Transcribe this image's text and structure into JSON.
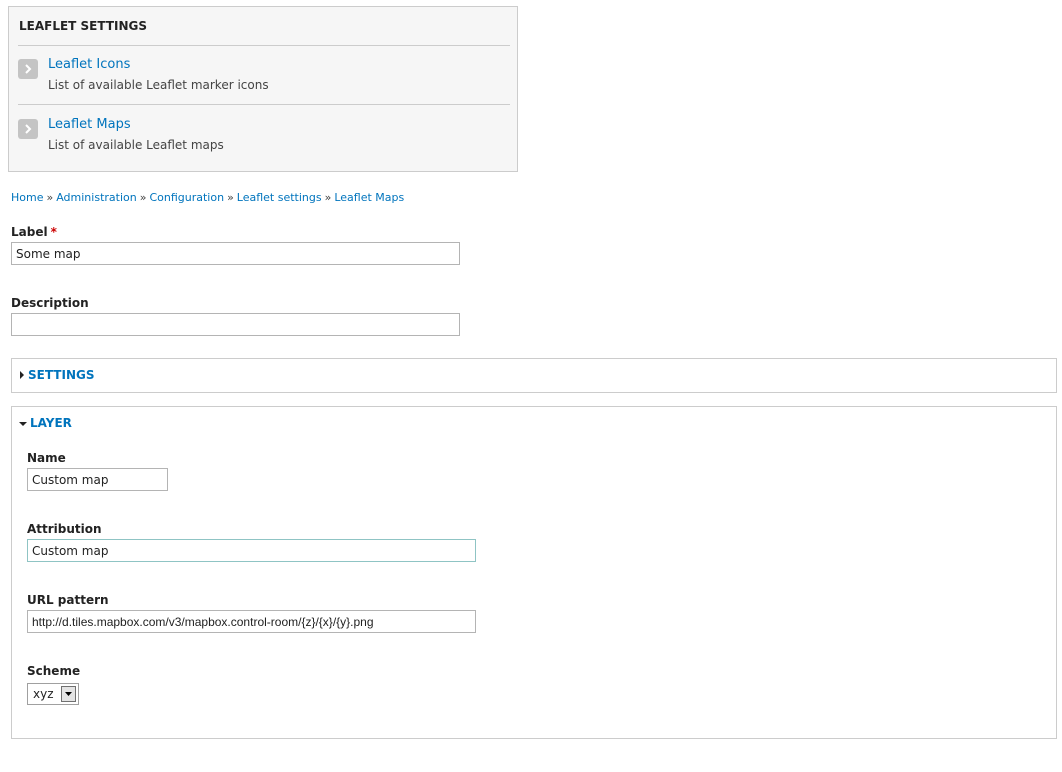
{
  "admin_block": {
    "title": "LEAFLET SETTINGS",
    "items": [
      {
        "label": "Leaflet Icons",
        "description": "List of available Leaflet marker icons",
        "icon": "chevron-right-icon"
      },
      {
        "label": "Leaflet Maps",
        "description": "List of available Leaflet maps",
        "icon": "chevron-right-icon"
      }
    ]
  },
  "breadcrumb": {
    "items": [
      "Home",
      "Administration",
      "Configuration",
      "Leaflet settings",
      "Leaflet Maps"
    ],
    "separator": "»"
  },
  "form": {
    "label": {
      "label": "Label",
      "required_marker": "*",
      "value": "Some map"
    },
    "description": {
      "label": "Description",
      "value": ""
    },
    "settings_fieldset": {
      "legend": "SETTINGS",
      "state": "collapsed"
    },
    "layer_fieldset": {
      "legend": "LAYER",
      "state": "expanded",
      "name": {
        "label": "Name",
        "value": "Custom map"
      },
      "attribution": {
        "label": "Attribution",
        "value": "Custom map"
      },
      "url_pattern": {
        "label": "URL pattern",
        "value": "http://d.tiles.mapbox.com/v3/mapbox.control-room/{z}/{x}/{y}.png"
      },
      "scheme": {
        "label": "Scheme",
        "selected": "xyz"
      }
    }
  },
  "colors": {
    "link": "#0074bd",
    "required": "#cc0000",
    "panel_bg": "#f6f6f6",
    "border": "#cccccc"
  }
}
